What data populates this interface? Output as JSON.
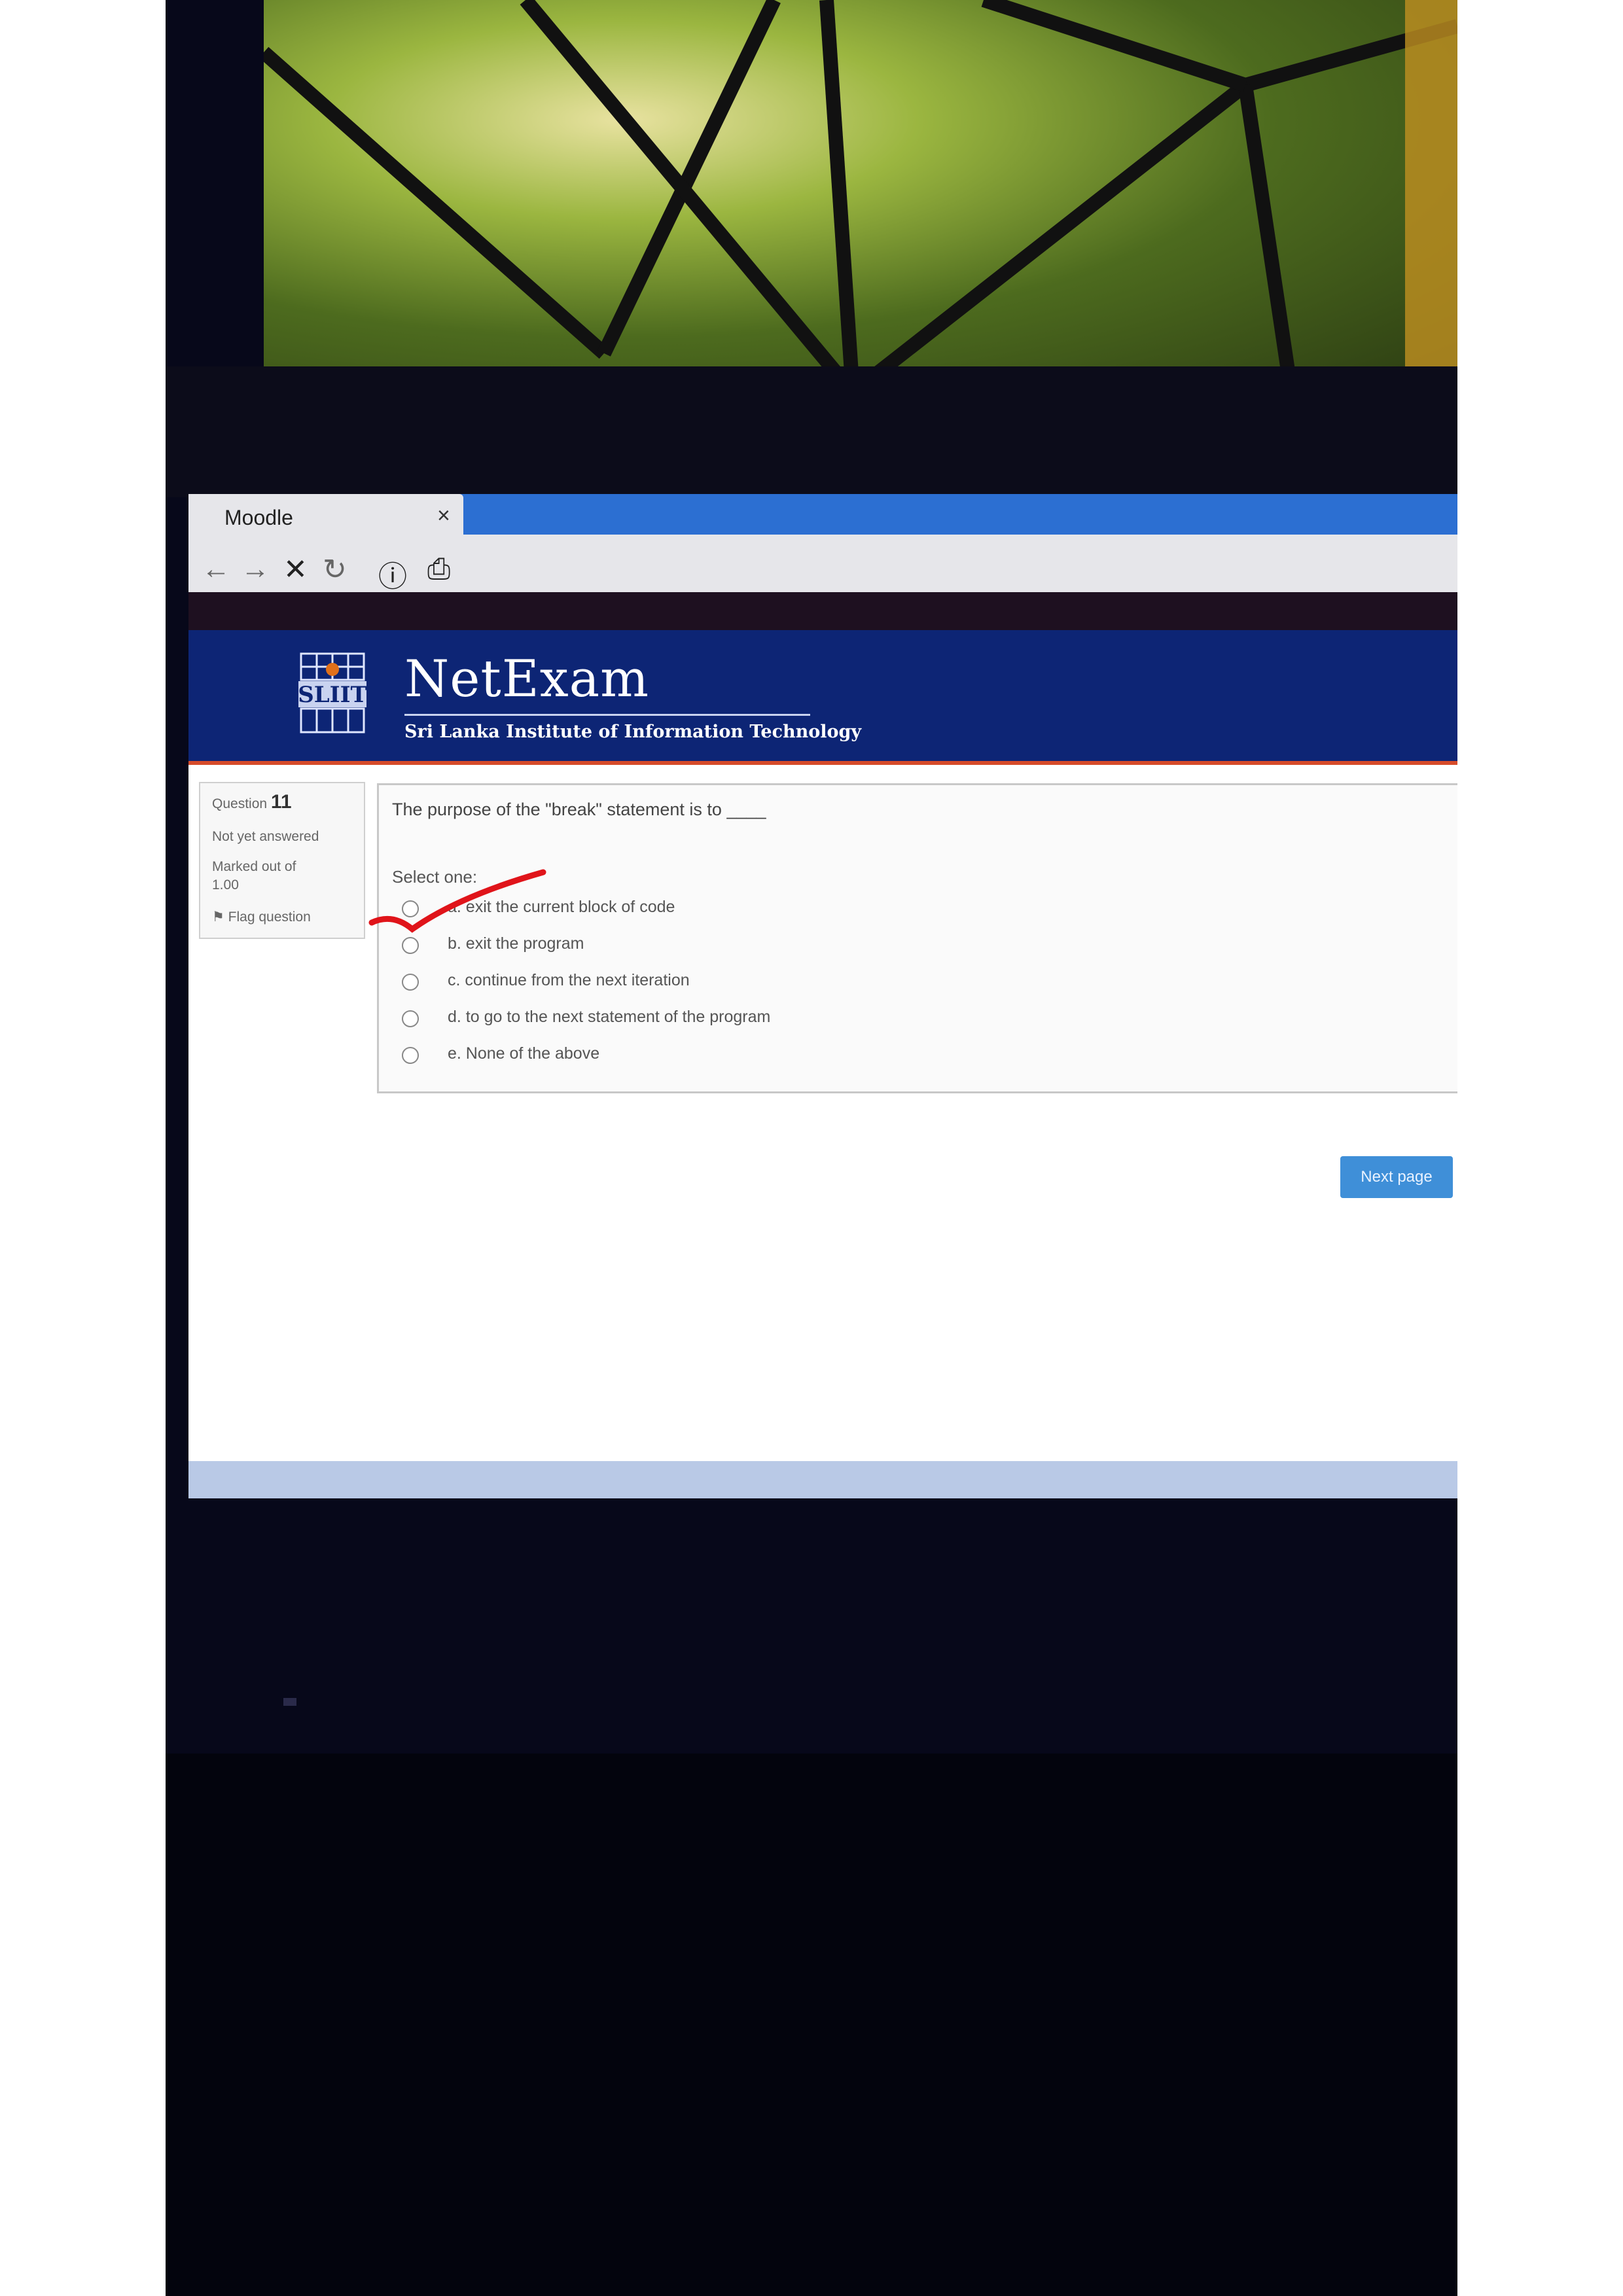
{
  "browser": {
    "tab_title": "Moodle",
    "tab_close": "×",
    "nav": {
      "back": "←",
      "forward": "→",
      "stop": "✕",
      "reload": "↻",
      "info": "ⓘ",
      "page": "⎙"
    }
  },
  "banner": {
    "logo_text": "SLIIT",
    "brand": "NetExam",
    "subtitle": "Sri Lanka Institute of Information Technology"
  },
  "question_info": {
    "label": "Question",
    "number": "11",
    "status": "Not yet answered",
    "marked": "Marked out of",
    "marks": "1.00",
    "flag": "Flag question"
  },
  "question": {
    "text": "The purpose of the \"break\" statement is to ____",
    "select_label": "Select one:",
    "options": [
      {
        "label": "a. exit the current block of code"
      },
      {
        "label": "b. exit the program"
      },
      {
        "label": "c. continue from the next iteration"
      },
      {
        "label": "d. to go to the next statement of the program"
      },
      {
        "label": "e. None of the above"
      }
    ]
  },
  "next_button": "Next page",
  "colors": {
    "banner": "#0d2575",
    "accent": "#d64b2a",
    "button": "#3f8fd8",
    "annotation": "#e0141a"
  }
}
